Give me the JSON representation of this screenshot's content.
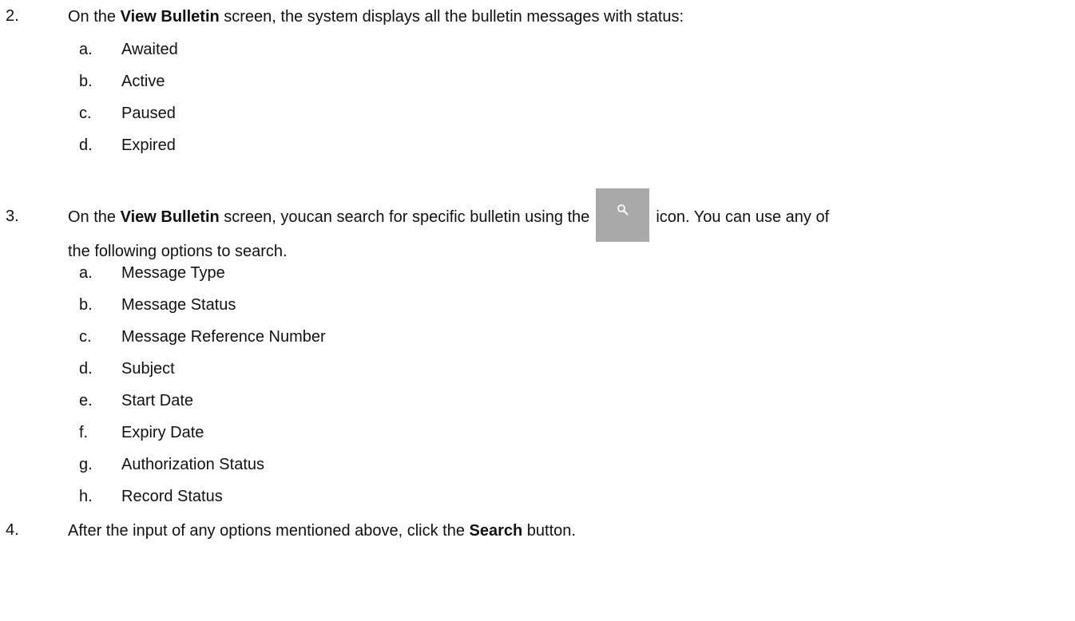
{
  "step2": {
    "number": "2.",
    "text_before": "On the ",
    "bold": "View Bulletin",
    "text_after": " screen, the system displays all the bulletin messages with status:",
    "items": [
      {
        "letter": "a.",
        "label": "Awaited"
      },
      {
        "letter": "b.",
        "label": "Active"
      },
      {
        "letter": "c.",
        "label": "Paused"
      },
      {
        "letter": "d.",
        "label": "Expired"
      }
    ]
  },
  "step3": {
    "number": "3.",
    "text_before": "On the ",
    "bold": "View Bulletin",
    "text_middle": " screen, youcan search for specific bulletin using the",
    "icon": "search-icon",
    "icon_color": "#a9a9a9",
    "text_after": "icon. You can use any of",
    "text_line2": "the following options to search.",
    "items": [
      {
        "letter": "a.",
        "label": "Message Type"
      },
      {
        "letter": "b.",
        "label": "Message Status"
      },
      {
        "letter": "c.",
        "label": "Message Reference Number"
      },
      {
        "letter": "d.",
        "label": "Subject"
      },
      {
        "letter": "e.",
        "label": "Start Date"
      },
      {
        "letter": "f.",
        "label": "Expiry Date"
      },
      {
        "letter": "g.",
        "label": "Authorization Status"
      },
      {
        "letter": "h.",
        "label": "Record Status"
      }
    ]
  },
  "step4": {
    "number": "4.",
    "text_before": "After the input of any options mentioned above, click the ",
    "bold": "Search",
    "text_after": " button."
  }
}
